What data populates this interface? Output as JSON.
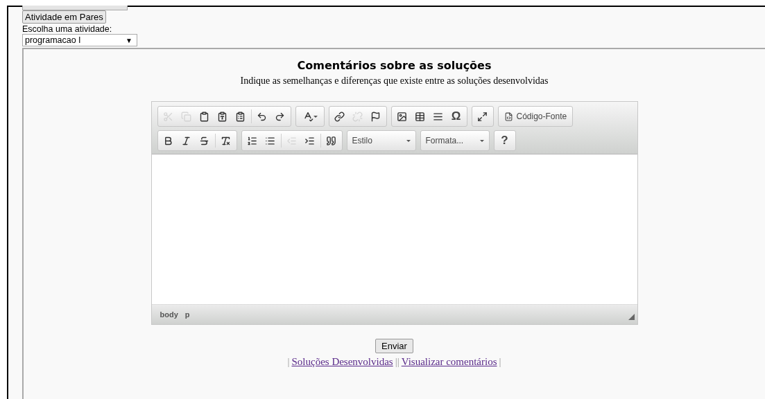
{
  "top_buttons": [
    {
      "label": "Atividade em Pares"
    }
  ],
  "activity_select": {
    "label": "Escolha uma atividade:",
    "value": "programacao I",
    "arrow": "▼"
  },
  "heading": {
    "title": "Comentários sobre as soluções",
    "subtitle": "Indique as semelhanças e diferenças que existe entre as soluções desenvolvidas"
  },
  "editor": {
    "toolbar_rows": [
      [
        {
          "items": [
            {
              "kind": "icon",
              "disabled": true
            },
            {
              "kind": "icon",
              "disabled": true
            },
            {
              "kind": "icon",
              "disabled": false
            },
            {
              "kind": "icon",
              "disabled": false
            },
            {
              "kind": "icon",
              "disabled": false
            },
            {
              "kind": "separator"
            },
            {
              "kind": "icon",
              "disabled": false
            },
            {
              "kind": "icon",
              "disabled": false
            }
          ]
        },
        {
          "items": [
            {
              "kind": "menu-icon",
              "disabled": false
            }
          ]
        },
        {
          "items": [
            {
              "kind": "icon",
              "disabled": false
            },
            {
              "kind": "icon",
              "disabled": true
            },
            {
              "kind": "icon",
              "disabled": false
            }
          ]
        },
        {
          "items": [
            {
              "kind": "icon",
              "disabled": false
            },
            {
              "kind": "icon",
              "disabled": false
            },
            {
              "kind": "icon",
              "disabled": false
            },
            {
              "kind": "glyph",
              "label": "Ω",
              "disabled": false
            }
          ]
        },
        {
          "items": [
            {
              "kind": "icon",
              "disabled": false
            }
          ]
        },
        {
          "items": [
            {
              "kind": "labeled-icon",
              "label": "Código-Fonte",
              "disabled": false
            }
          ]
        }
      ],
      [
        {
          "items": [
            {
              "kind": "icon",
              "disabled": false
            },
            {
              "kind": "icon",
              "disabled": false
            },
            {
              "kind": "icon",
              "disabled": false
            },
            {
              "kind": "separator"
            },
            {
              "kind": "icon",
              "disabled": false
            }
          ]
        },
        {
          "items": [
            {
              "kind": "icon",
              "disabled": false
            },
            {
              "kind": "icon",
              "disabled": false
            },
            {
              "kind": "separator"
            },
            {
              "kind": "icon",
              "disabled": true
            },
            {
              "kind": "icon",
              "disabled": false
            },
            {
              "kind": "separator"
            },
            {
              "kind": "icon",
              "disabled": false
            }
          ]
        },
        {
          "items": [
            {
              "kind": "dropdown",
              "label": "Estilo"
            }
          ]
        },
        {
          "items": [
            {
              "kind": "dropdown",
              "label": "Formata..."
            }
          ]
        },
        {
          "items": [
            {
              "kind": "glyph",
              "label": "?",
              "disabled": false
            }
          ]
        }
      ]
    ],
    "path": [
      "body",
      "p"
    ]
  },
  "submit": {
    "label": "Enviar"
  },
  "links": [
    {
      "label": "Soluções Desenvolvidas"
    },
    {
      "label": "Visualizar comentários"
    }
  ],
  "link_separators": [
    "|",
    "||",
    "|"
  ]
}
